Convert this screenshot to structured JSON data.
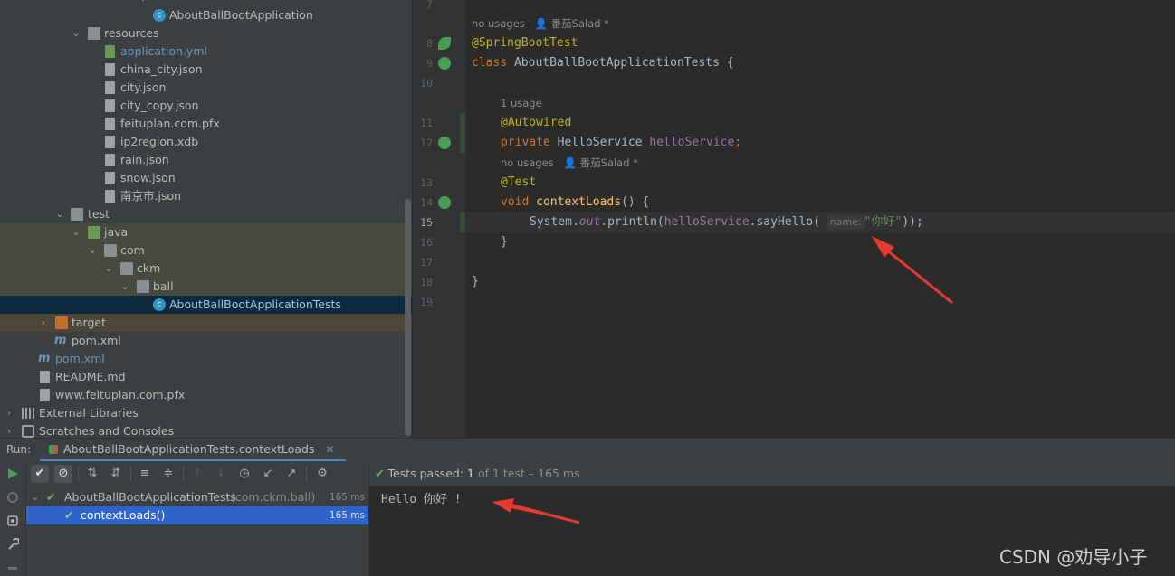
{
  "project_tree": {
    "rows": [
      {
        "label": "AboutBallBootApplication",
        "kind": "class"
      },
      {
        "label": "resources",
        "kind": "folder"
      },
      {
        "label": "application.yml",
        "kind": "yml"
      },
      {
        "label": "china_city.json",
        "kind": "file"
      },
      {
        "label": "city.json",
        "kind": "file"
      },
      {
        "label": "city_copy.json",
        "kind": "file"
      },
      {
        "label": "feituplan.com.pfx",
        "kind": "file"
      },
      {
        "label": "ip2region.xdb",
        "kind": "file"
      },
      {
        "label": "rain.json",
        "kind": "file"
      },
      {
        "label": "snow.json",
        "kind": "file"
      },
      {
        "label": "南京市.json",
        "kind": "file"
      },
      {
        "label": "test",
        "kind": "folder"
      },
      {
        "label": "java",
        "kind": "folder"
      },
      {
        "label": "com",
        "kind": "package"
      },
      {
        "label": "ckm",
        "kind": "package"
      },
      {
        "label": "ball",
        "kind": "package"
      },
      {
        "label": "AboutBallBootApplicationTests",
        "kind": "class"
      },
      {
        "label": "target",
        "kind": "folder"
      },
      {
        "label": "pom.xml",
        "kind": "maven"
      },
      {
        "label": "pom.xml",
        "kind": "maven"
      },
      {
        "label": "README.md",
        "kind": "file"
      },
      {
        "label": "www.feituplan.com.pfx",
        "kind": "file"
      },
      {
        "label": "External Libraries",
        "kind": "lib"
      },
      {
        "label": "Scratches and Consoles",
        "kind": "scratch"
      }
    ]
  },
  "editor": {
    "line_numbers": [
      "7",
      "8",
      "9",
      "10",
      "11",
      "12",
      "13",
      "14",
      "15",
      "16",
      "17",
      "18",
      "19"
    ],
    "hints": {
      "class_usages": "no usages",
      "class_author": "番茄Salad *",
      "field_usages": "1 usage",
      "method_usages": "no usages",
      "method_author": "番茄Salad *"
    },
    "code": {
      "l8_ann": "@SpringBootTest",
      "l9_kw": "class",
      "l9_name": " AboutBallBootApplicationTests {",
      "l11_ann": "@Autowired",
      "l12_kw": "private",
      "l12_type": " HelloService ",
      "l12_field": "helloService",
      "l12_end": ";",
      "l13_ann": "@Test",
      "l14_kw": "void",
      "l14_fn": " contextLoads",
      "l14_end": "() {",
      "l15_a": "System.",
      "l15_out": "out",
      "l15_b": ".println(",
      "l15_field": "helloService",
      "l15_c": ".sayHello(",
      "l15_param": "name:",
      "l15_str": "\"你好\"",
      "l15_end": "));",
      "l16": "}",
      "l18": "}"
    }
  },
  "run": {
    "label": "Run:",
    "tab_title": "AboutBallBootApplicationTests.contextLoads",
    "tab_close": "✕",
    "status_passed": "Tests passed:",
    "status_count": "1",
    "status_rest": "of 1 test – 165 ms",
    "tests": [
      {
        "name": "AboutBallBootApplicationTests",
        "pkg": "(com.ckm.ball)",
        "time": "165 ms"
      },
      {
        "name": "contextLoads()",
        "time": "165 ms"
      }
    ],
    "output": "Hello 你好 !"
  },
  "watermark": "CSDN @劝导小子",
  "colors": {
    "accent": "#2f65ca",
    "pass_green": "#5eb55e",
    "arrow_red": "#e53a2f"
  }
}
